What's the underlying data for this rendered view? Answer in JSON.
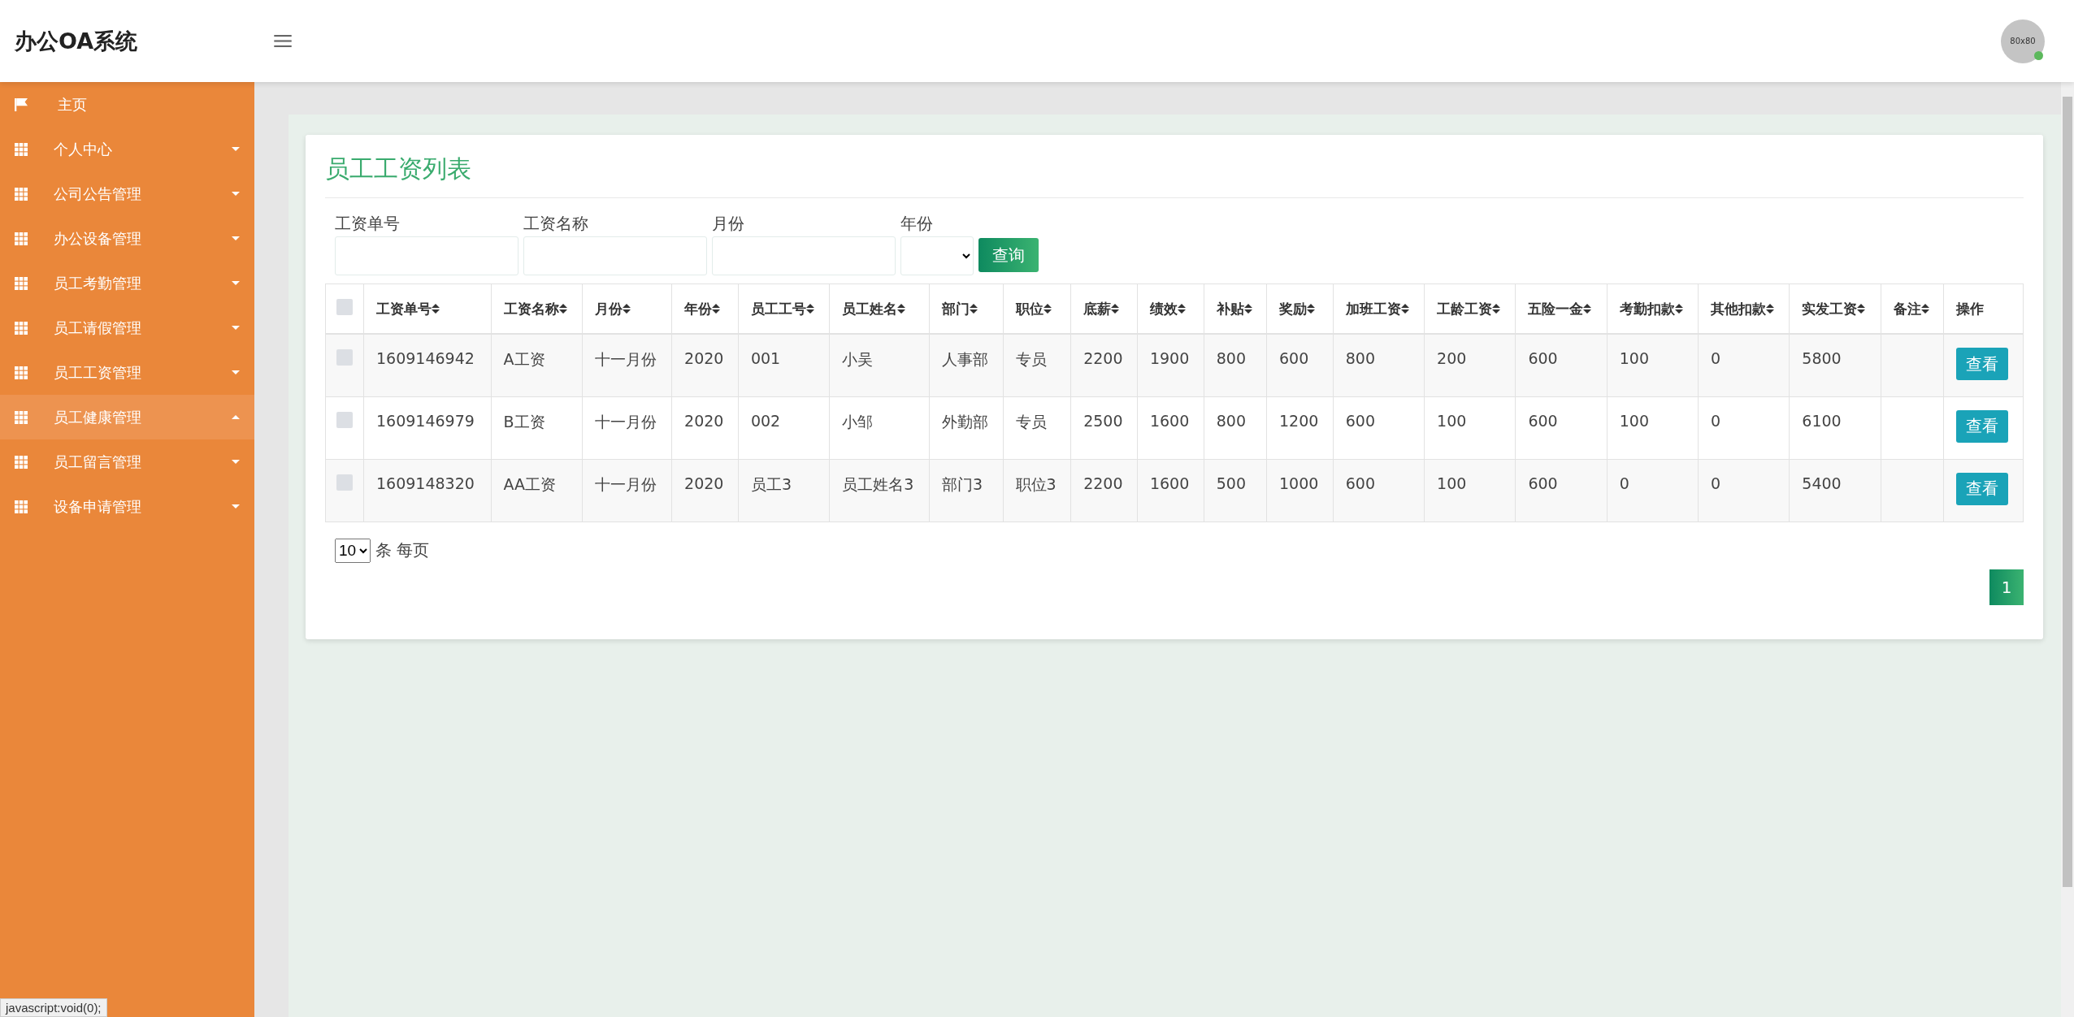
{
  "header": {
    "logo": "办公OA系统",
    "avatar_text": "80x80",
    "online": true
  },
  "sidebar": {
    "items": [
      {
        "kind": "link",
        "label": "主页",
        "selected": false
      },
      {
        "kind": "menu",
        "label": "个人中心",
        "selected": false,
        "expanded": false
      },
      {
        "kind": "menu",
        "label": "公司公告管理",
        "selected": false,
        "expanded": false
      },
      {
        "kind": "menu",
        "label": "办公设备管理",
        "selected": false,
        "expanded": false
      },
      {
        "kind": "menu",
        "label": "员工考勤管理",
        "selected": false,
        "expanded": false
      },
      {
        "kind": "menu",
        "label": "员工请假管理",
        "selected": false,
        "expanded": false
      },
      {
        "kind": "menu",
        "label": "员工工资管理",
        "selected": false,
        "expanded": false
      },
      {
        "kind": "menu",
        "label": "员工健康管理",
        "selected": true,
        "expanded": true
      },
      {
        "kind": "menu",
        "label": "员工留言管理",
        "selected": false,
        "expanded": false
      },
      {
        "kind": "menu",
        "label": "设备申请管理",
        "selected": false,
        "expanded": false
      }
    ]
  },
  "panel": {
    "title": "员工工资列表",
    "filters": [
      {
        "kind": "text",
        "label": "工资单号"
      },
      {
        "kind": "text",
        "label": "工资名称"
      },
      {
        "kind": "text",
        "label": "月份"
      },
      {
        "kind": "select",
        "label": "年份"
      }
    ],
    "search_button": "查询",
    "table": {
      "select_all_checked": false,
      "columns": [
        {
          "label": "工资单号",
          "sortable": true
        },
        {
          "label": "工资名称",
          "sortable": true
        },
        {
          "label": "月份",
          "sortable": true
        },
        {
          "label": "年份",
          "sortable": true
        },
        {
          "label": "员工工号",
          "sortable": true
        },
        {
          "label": "员工姓名",
          "sortable": true
        },
        {
          "label": "部门",
          "sortable": true
        },
        {
          "label": "职位",
          "sortable": true
        },
        {
          "label": "底薪",
          "sortable": true
        },
        {
          "label": "绩效",
          "sortable": true
        },
        {
          "label": "补贴",
          "sortable": true
        },
        {
          "label": "奖励",
          "sortable": true
        },
        {
          "label": "加班工资",
          "sortable": true
        },
        {
          "label": "工龄工资",
          "sortable": true
        },
        {
          "label": "五险一金",
          "sortable": true
        },
        {
          "label": "考勤扣款",
          "sortable": true
        },
        {
          "label": "其他扣款",
          "sortable": true
        },
        {
          "label": "实发工资",
          "sortable": true
        },
        {
          "label": "备注",
          "sortable": true
        },
        {
          "label": "操作",
          "sortable": false
        }
      ],
      "rows": [
        {
          "checked": false,
          "cells": [
            "1609146942",
            "A工资",
            "十一月份",
            "2020",
            "001",
            "小吴",
            "人事部",
            "专员",
            "2200",
            "1900",
            "800",
            "600",
            "800",
            "200",
            "600",
            "100",
            "0",
            "5800"
          ],
          "action": "查看"
        },
        {
          "checked": false,
          "cells": [
            "1609146979",
            "B工资",
            "十一月份",
            "2020",
            "002",
            "小邹",
            "外勤部",
            "专员",
            "2500",
            "1600",
            "800",
            "1200",
            "600",
            "100",
            "600",
            "100",
            "0",
            "6100"
          ],
          "action": "查看"
        },
        {
          "checked": false,
          "cells": [
            "1609148320",
            "AA工资",
            "十一月份",
            "2020",
            "员工3",
            "员工姓名3",
            "部门3",
            "职位3",
            "2200",
            "1600",
            "500",
            "1000",
            "600",
            "100",
            "600",
            "0",
            "0",
            "5400"
          ],
          "action": "查看"
        }
      ]
    },
    "page_size": "10",
    "page_size_label": "条 每页",
    "pages": [
      {
        "label": "1",
        "selected": true
      }
    ]
  },
  "status_bar": "javascript:void(0);"
}
